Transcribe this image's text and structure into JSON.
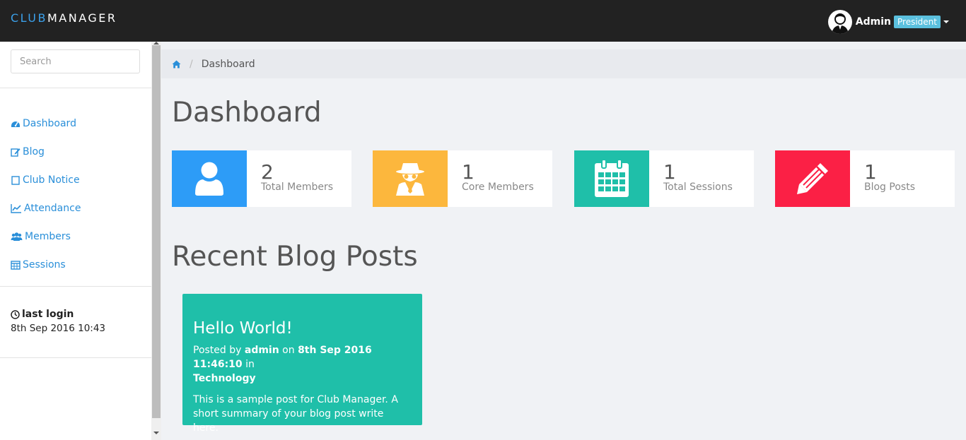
{
  "brand": {
    "part1": "CLUB",
    "part2": "MANAGER"
  },
  "user": {
    "name": "Admin",
    "role": "President"
  },
  "search": {
    "placeholder": "Search"
  },
  "nav": [
    {
      "label": "Dashboard",
      "icon": "dashboard-icon"
    },
    {
      "label": "Blog",
      "icon": "edit-icon"
    },
    {
      "label": "Club Notice",
      "icon": "notice-icon"
    },
    {
      "label": "Attendance",
      "icon": "line-chart-icon"
    },
    {
      "label": "Members",
      "icon": "users-icon"
    },
    {
      "label": "Sessions",
      "icon": "calendar-icon"
    }
  ],
  "last_login": {
    "label": "last login",
    "time": "8th Sep 2016 10:43"
  },
  "breadcrumb": {
    "current": "Dashboard"
  },
  "page_title": "Dashboard",
  "stats": [
    {
      "value": "2",
      "label": "Total Members",
      "color": "#2d9cf7",
      "icon": "user-icon"
    },
    {
      "value": "1",
      "label": "Core Members",
      "color": "#fcb73d",
      "icon": "spy-icon"
    },
    {
      "value": "1",
      "label": "Total Sessions",
      "color": "#1fbfa9",
      "icon": "calendar-icon"
    },
    {
      "value": "1",
      "label": "Blog Posts",
      "color": "#fb2045",
      "icon": "pencil-icon"
    }
  ],
  "recent_title": "Recent Blog Posts",
  "post": {
    "title": "Hello World!",
    "posted_by_prefix": "Posted by",
    "author": "admin",
    "on": "on",
    "date": "8th Sep 2016 11:46:10",
    "in": "in",
    "category": "Technology",
    "summary": "This is a sample post for Club Manager. A short summary of your blog post write here.",
    "color": "#1fbfa9"
  }
}
